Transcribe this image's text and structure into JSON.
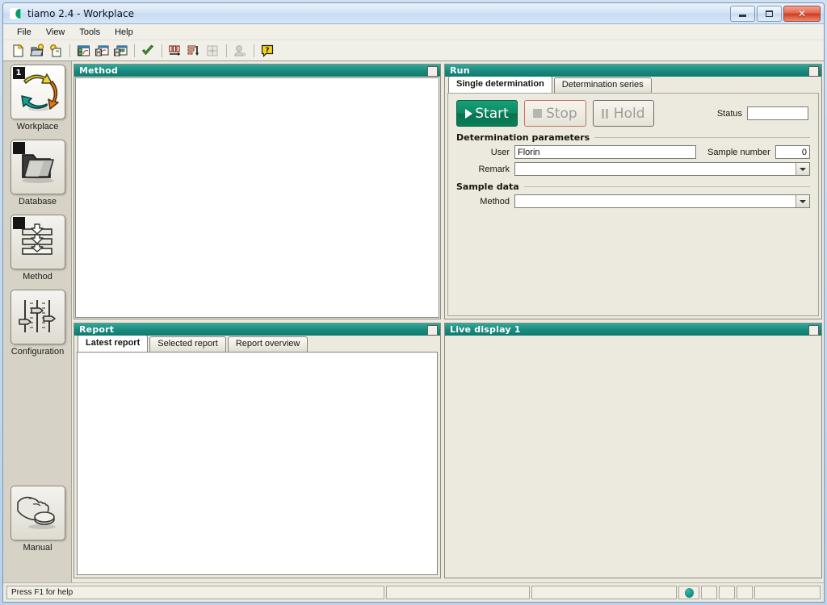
{
  "window": {
    "title": "tiamo 2.4 - Workplace",
    "logo_icon": "tiamo-logo-icon",
    "controls": {
      "minimize": "minimize-icon",
      "maximize": "maximize-icon",
      "close": "✕"
    }
  },
  "menubar": {
    "items": [
      {
        "label": "File"
      },
      {
        "label": "View"
      },
      {
        "label": "Tools"
      },
      {
        "label": "Help"
      }
    ]
  },
  "toolbar": {
    "groups": [
      {
        "buttons": [
          {
            "name": "new-icon",
            "title": "New"
          },
          {
            "name": "open-icon",
            "title": "Open"
          },
          {
            "name": "save-as-icon",
            "title": "Save as"
          }
        ]
      },
      {
        "buttons": [
          {
            "name": "live-display-icon",
            "title": "Live display"
          },
          {
            "name": "determination-data-icon",
            "title": "Determination data"
          },
          {
            "name": "save-determination-icon",
            "title": "Save determination"
          }
        ]
      },
      {
        "buttons": [
          {
            "name": "check-icon",
            "title": "Validate"
          }
        ]
      },
      {
        "buttons": [
          {
            "name": "column-chart-icon",
            "title": "Results"
          },
          {
            "name": "list-down-icon",
            "title": "Sort"
          },
          {
            "name": "grid-icon",
            "title": "Table (disabled)"
          }
        ]
      },
      {
        "buttons": [
          {
            "name": "user-icon",
            "title": "User (disabled)"
          }
        ]
      },
      {
        "buttons": [
          {
            "name": "help-icon",
            "title": "Help"
          }
        ]
      }
    ]
  },
  "sidebar": {
    "items": [
      {
        "label": "Workplace",
        "icon": "recycle-arrows-icon",
        "badge": "1",
        "active": true
      },
      {
        "label": "Database",
        "icon": "folder-icon",
        "badge": "",
        "active": false
      },
      {
        "label": "Method",
        "icon": "method-stack-icon",
        "badge": "",
        "active": false
      },
      {
        "label": "Configuration",
        "icon": "sliders-icon",
        "badge": null,
        "active": false
      },
      {
        "label": "Manual",
        "icon": "hand-button-icon",
        "badge": null,
        "active": false
      }
    ]
  },
  "panels": {
    "method": {
      "title": "Method"
    },
    "run": {
      "title": "Run",
      "tabs": [
        {
          "label": "Single determination",
          "active": true
        },
        {
          "label": "Determination series",
          "active": false
        }
      ],
      "buttons": [
        {
          "label": "Start",
          "icon": "play-icon",
          "state": "enabled"
        },
        {
          "label": "Stop",
          "icon": "stop-square-icon",
          "state": "disabled"
        },
        {
          "label": "Hold",
          "icon": "pause-icon",
          "state": "disabled"
        }
      ],
      "status": {
        "label": "Status",
        "value": ""
      },
      "groups": [
        {
          "title": "Determination parameters",
          "fields": [
            {
              "label": "User",
              "value": "Florin",
              "type": "text"
            },
            {
              "label": "Sample number",
              "value": "0",
              "type": "number"
            },
            {
              "label": "Remark",
              "value": "",
              "type": "combo"
            }
          ]
        },
        {
          "title": "Sample data",
          "fields": [
            {
              "label": "Method",
              "value": "",
              "type": "combo"
            }
          ]
        }
      ]
    },
    "report": {
      "title": "Report",
      "tabs": [
        {
          "label": "Latest report",
          "active": true
        },
        {
          "label": "Selected report",
          "active": false
        },
        {
          "label": "Report overview",
          "active": false
        }
      ],
      "content": ""
    },
    "live_display": {
      "title": "Live display 1",
      "content": ""
    }
  },
  "statusbar": {
    "help_text": "Press F1 for help",
    "cells": [
      "",
      "",
      ""
    ],
    "led": {
      "name": "connection-led",
      "color": "#0f8d7d"
    }
  },
  "colors": {
    "panel_header_teal": "#19897c",
    "start_green": "#0d8a63",
    "stop_red_border": "#c0705d",
    "window_bg": "#eceadf",
    "led_teal": "#0f8d7d"
  }
}
